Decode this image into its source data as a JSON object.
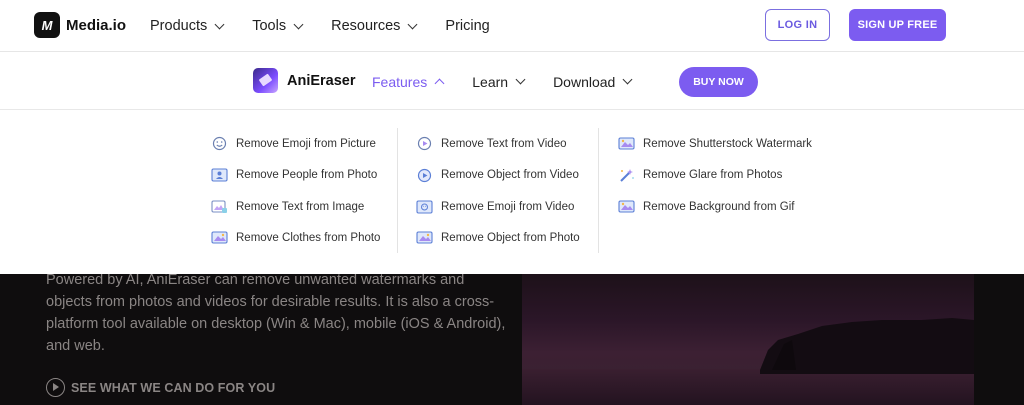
{
  "header": {
    "logo_text": "Media.io",
    "logo_mark": "M",
    "nav": [
      {
        "label": "Products"
      },
      {
        "label": "Tools"
      },
      {
        "label": "Resources"
      },
      {
        "label": "Pricing"
      }
    ],
    "login_label": "LOG IN",
    "signup_label": "SIGN UP FREE"
  },
  "subheader": {
    "product_name": "AniEraser",
    "nav": [
      {
        "label": "Features"
      },
      {
        "label": "Learn"
      },
      {
        "label": "Download"
      }
    ],
    "buy_label": "BUY NOW"
  },
  "dropdown": {
    "col1": [
      {
        "label": "Remove Emoji from Picture",
        "icon": "emoji-icon"
      },
      {
        "label": "Remove People from Photo",
        "icon": "people-photo-icon"
      },
      {
        "label": "Remove Text from Image",
        "icon": "text-image-icon"
      },
      {
        "label": "Remove Clothes from Photo",
        "icon": "clothes-photo-icon"
      }
    ],
    "col2": [
      {
        "label": "Remove Text from Video",
        "icon": "text-video-icon"
      },
      {
        "label": "Remove Object from Video",
        "icon": "object-video-icon"
      },
      {
        "label": "Remove Emoji from Video",
        "icon": "emoji-video-icon"
      },
      {
        "label": "Remove Object from Photo",
        "icon": "object-photo-icon"
      }
    ],
    "col3": [
      {
        "label": "Remove Shutterstock Watermark",
        "icon": "watermark-icon"
      },
      {
        "label": "Remove Glare from Photos",
        "icon": "magic-wand-icon"
      },
      {
        "label": "Remove Background from Gif",
        "icon": "gif-background-icon"
      }
    ]
  },
  "hero": {
    "description": "Powered by AI, AniEraser can remove unwanted watermarks and objects from photos and videos for desirable results. It is also a cross-platform tool available on desktop (Win & Mac), mobile (iOS & Android), and web.",
    "cta_label": "SEE WHAT WE CAN DO FOR YOU"
  },
  "colors": {
    "accent": "#7c5cf0",
    "hero_bg": "#0f0d0e"
  }
}
